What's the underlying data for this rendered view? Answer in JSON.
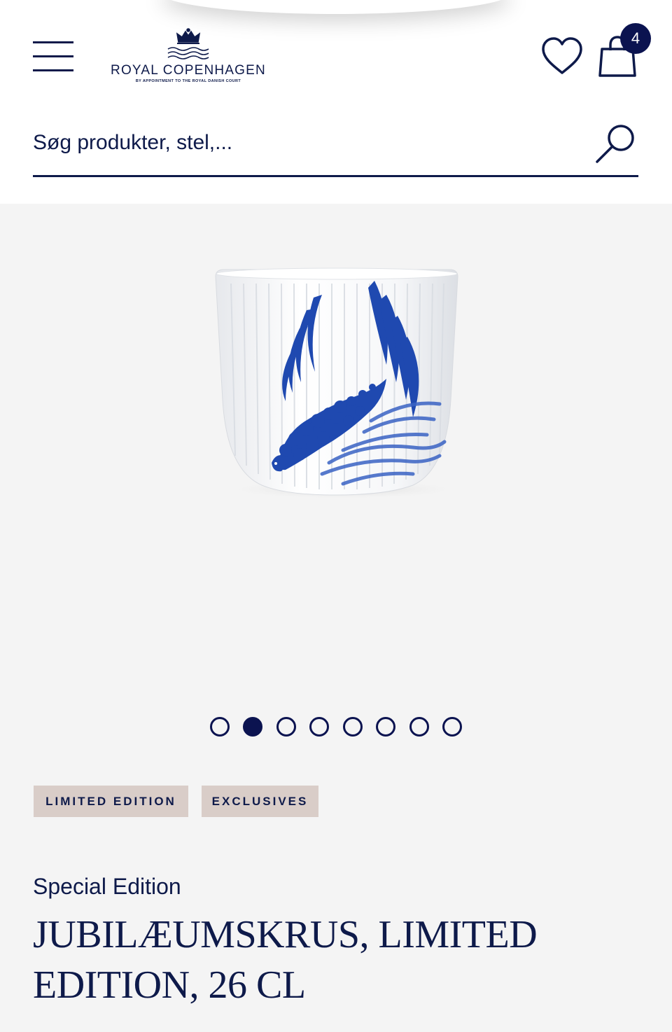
{
  "header": {
    "brand": "ROYAL COPENHAGEN",
    "brand_tagline": "BY APPOINTMENT TO THE ROYAL DANISH COURT",
    "cart_count": "4",
    "icons": [
      "menu-icon",
      "crown-icon",
      "heart-icon",
      "shopping-bag-icon"
    ]
  },
  "search": {
    "placeholder": "Søg produkter, stel,...",
    "icon": "search-icon"
  },
  "gallery": {
    "slide_count": 8,
    "active_slide": 2
  },
  "tags": [
    "LIMITED EDITION",
    "EXCLUSIVES"
  ],
  "product": {
    "category": "Special Edition",
    "title": "JUBILÆUMSKRUS, LIMITED EDITION, 26 CL"
  },
  "colors": {
    "brand_navy": "#0e1a4a",
    "badge_navy": "#0b1350",
    "tag_background": "#d9cdc8",
    "gallery_background": "#f4f4f4",
    "pattern_blue": "#1f49b0"
  }
}
